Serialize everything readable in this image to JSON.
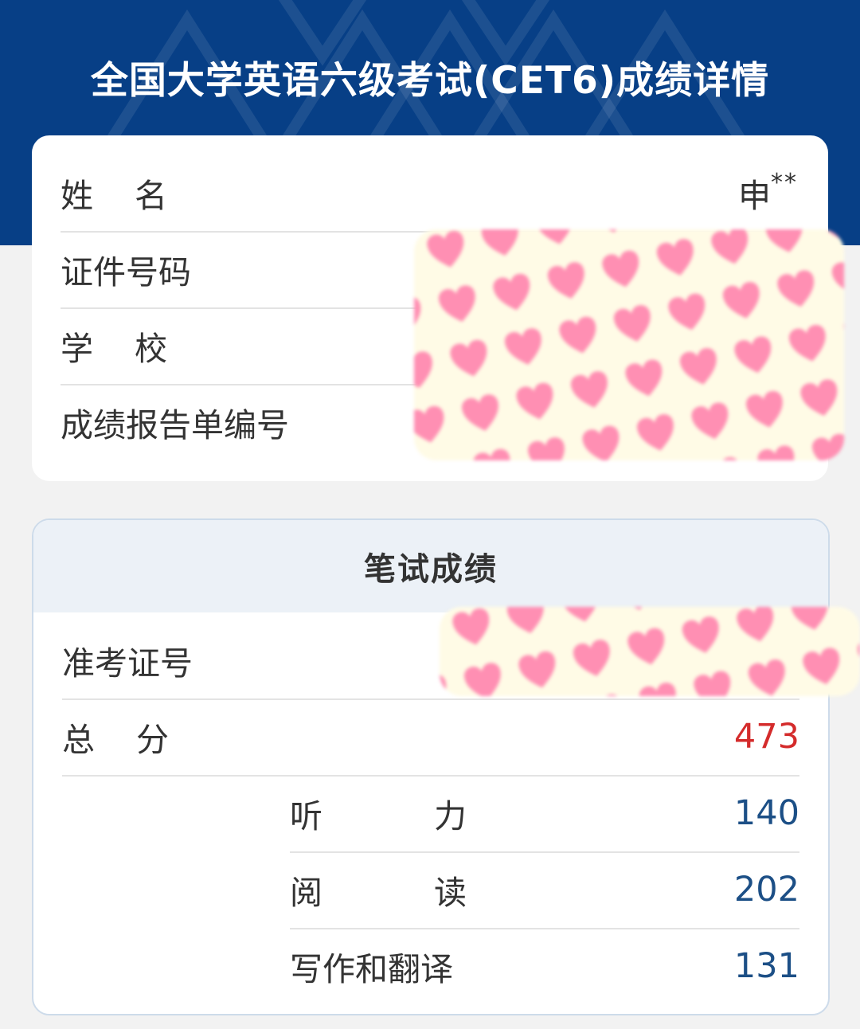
{
  "header": {
    "title": "全国大学英语六级考试(CET6)成绩详情",
    "background_color": "#073f86"
  },
  "info": {
    "name_label": "姓名",
    "name_value": "申",
    "name_mask": "**",
    "id_label": "证件号码",
    "school_label": "学校",
    "report_label": "成绩报告单编号"
  },
  "written": {
    "title": "笔试成绩",
    "ticket_label": "准考证号",
    "total_label": "总分",
    "total_value": "473",
    "total_color": "#d42b2b",
    "sections": [
      {
        "label": "听力",
        "value": "140"
      },
      {
        "label": "阅读",
        "value": "202"
      },
      {
        "label": "写作和翻译",
        "value": "131"
      }
    ]
  },
  "redaction": {
    "pattern_icon": "heart-icon",
    "heart_color": "#ff8fb3",
    "background_color": "#fffbe6"
  }
}
